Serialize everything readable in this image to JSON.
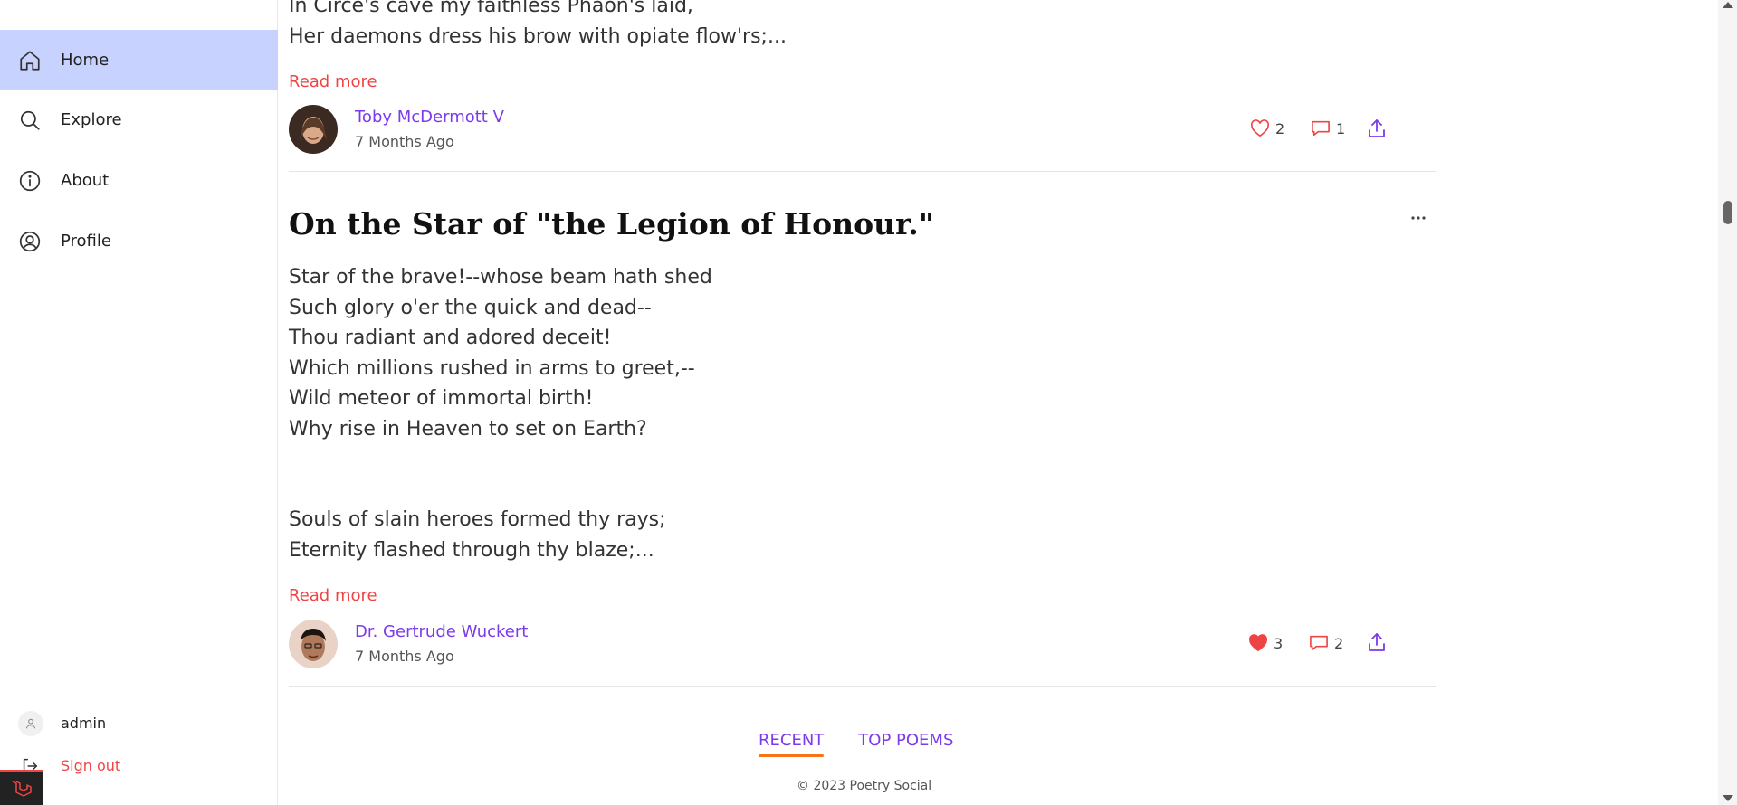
{
  "sidebar": {
    "nav": [
      {
        "label": "Home",
        "icon": "home-icon",
        "active": true
      },
      {
        "label": "Explore",
        "icon": "search-icon",
        "active": false
      },
      {
        "label": "About",
        "icon": "info-icon",
        "active": false
      },
      {
        "label": "Profile",
        "icon": "user-circle-icon",
        "active": false
      }
    ],
    "user": {
      "name": "admin"
    },
    "signout": {
      "label": "Sign out"
    }
  },
  "posts": [
    {
      "excerpt": [
        "In Circe's cave my faithless Phaon's laid,",
        "Her daemons dress his brow with opiate flow'rs;..."
      ],
      "read_more": "Read more",
      "author": "Toby McDermott V",
      "time": "7 Months Ago",
      "likes": "2",
      "liked": false,
      "comments": "1"
    },
    {
      "title": "On the Star of \"the Legion of Honour.\"",
      "excerpt": [
        "Star of the brave!--whose beam hath shed",
        "Such glory o'er the quick and dead--",
        "Thou radiant and adored deceit!",
        "Which millions rushed in arms to greet,--",
        "Wild meteor of immortal birth!",
        "Why rise in Heaven to set on Earth?",
        "",
        "",
        "Souls of slain heroes formed thy rays;",
        "Eternity flashed through thy blaze;..."
      ],
      "read_more": "Read more",
      "author": "Dr. Gertrude Wuckert",
      "time": "7 Months Ago",
      "likes": "3",
      "liked": true,
      "comments": "2"
    }
  ],
  "tabs": [
    {
      "label": "RECENT",
      "active": true
    },
    {
      "label": "TOP POEMS",
      "active": false
    }
  ],
  "footer": {
    "copyright": "© 2023 Poetry Social"
  },
  "colors": {
    "accent": "#7c3aed",
    "active_nav": "#c7d2fe",
    "danger": "#ef4444",
    "tab_underline": "#f97316"
  }
}
